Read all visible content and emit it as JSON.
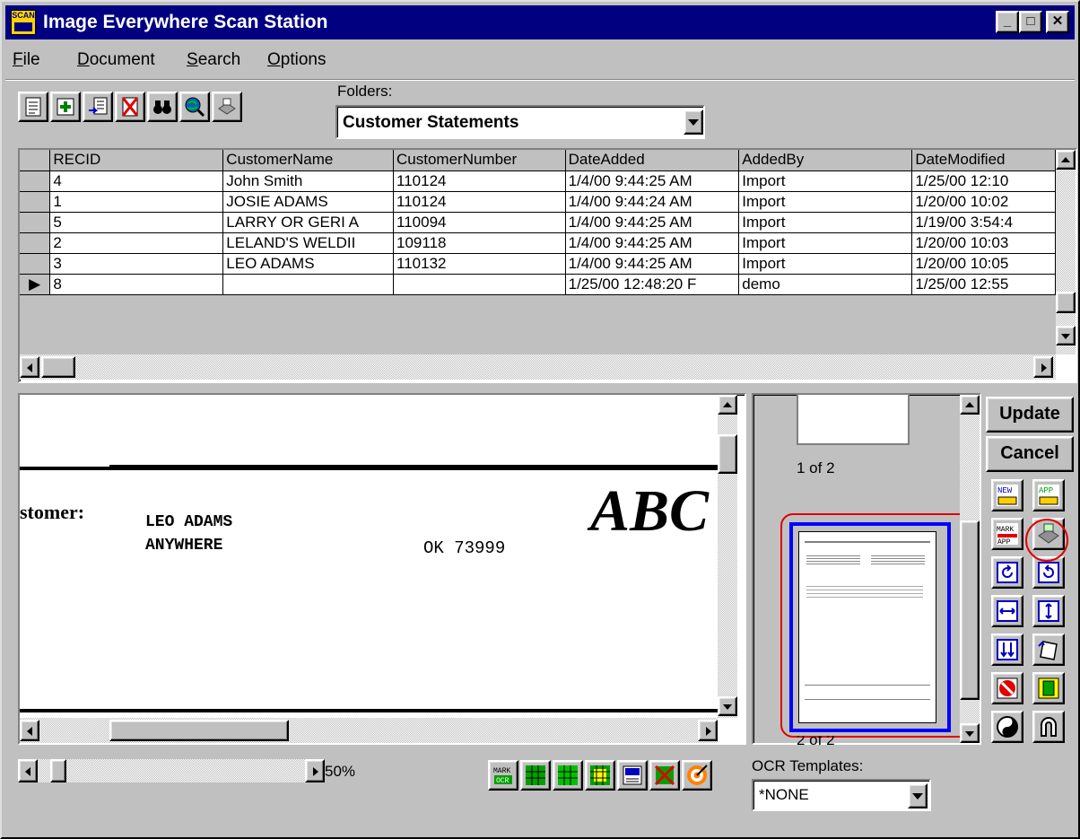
{
  "window": {
    "title": "Image Everywhere Scan Station",
    "icon_text": "SCAN",
    "minimize": "_",
    "maximize": "□",
    "close": "✕"
  },
  "menu": [
    {
      "label": "File",
      "key": "F",
      "rest": "ile"
    },
    {
      "label": "Document",
      "key": "D",
      "rest": "ocument"
    },
    {
      "label": "Search",
      "key": "S",
      "rest": "earch"
    },
    {
      "label": "Options",
      "key": "O",
      "rest": "ptions"
    }
  ],
  "toolbar": {
    "icons": [
      "new-document-icon",
      "add-icon",
      "scan-icon",
      "delete-icon",
      "find-binoculars-icon",
      "web-search-icon",
      "print-icon"
    ],
    "folders_label": "Folders:",
    "folder_value": "Customer Statements"
  },
  "grid": {
    "columns": [
      "RECID",
      "CustomerName",
      "CustomerNumber",
      "DateAdded",
      "AddedBy",
      "DateModified"
    ],
    "rows": [
      {
        "indicator": "",
        "cells": [
          "4",
          "John Smith",
          "110124",
          "1/4/00 9:44:25 AM",
          "Import",
          "1/25/00 12:10"
        ]
      },
      {
        "indicator": "",
        "cells": [
          "1",
          "JOSIE ADAMS",
          "110124",
          "1/4/00 9:44:24 AM",
          "Import",
          "1/20/00 10:02"
        ]
      },
      {
        "indicator": "",
        "cells": [
          "5",
          "LARRY OR GERI A",
          "110094",
          "1/4/00 9:44:25 AM",
          "Import",
          "1/19/00 3:54:4"
        ]
      },
      {
        "indicator": "",
        "cells": [
          "2",
          "LELAND'S WELDII",
          "109118",
          "1/4/00 9:44:25 AM",
          "Import",
          "1/20/00 10:03"
        ]
      },
      {
        "indicator": "",
        "cells": [
          "3",
          "LEO ADAMS",
          "110132",
          "1/4/00 9:44:25 AM",
          "Import",
          "1/20/00 10:05"
        ]
      },
      {
        "indicator": "▶",
        "cells": [
          "8",
          "",
          "",
          "1/25/00 12:48:20 F",
          "demo",
          "1/25/00 12:55"
        ]
      }
    ]
  },
  "document": {
    "customer_label": "stomer:",
    "name": "LEO ADAMS",
    "city": "ANYWHERE",
    "state_zip": "OK 73999",
    "logo_text": "ABC"
  },
  "thumbnails": {
    "page_label": "1 of 2",
    "next_label": "2 of 2"
  },
  "side": {
    "update": "Update",
    "cancel": "Cancel",
    "icons": [
      {
        "name": "new-page-icon",
        "text": "NEW"
      },
      {
        "name": "append-page-icon",
        "text": "APP"
      },
      {
        "name": "mark-append-icon",
        "text": "MARK"
      },
      {
        "name": "scanner-icon",
        "text": ""
      },
      {
        "name": "rotate-left-icon",
        "text": ""
      },
      {
        "name": "rotate-right-icon",
        "text": ""
      },
      {
        "name": "fit-width-icon",
        "text": ""
      },
      {
        "name": "fit-height-icon",
        "text": ""
      },
      {
        "name": "page-down-icon",
        "text": ""
      },
      {
        "name": "flip-page-icon",
        "text": ""
      },
      {
        "name": "despeckle-icon",
        "text": ""
      },
      {
        "name": "crop-icon",
        "text": ""
      },
      {
        "name": "contrast-icon",
        "text": ""
      },
      {
        "name": "magnet-icon",
        "text": ""
      }
    ]
  },
  "bottom": {
    "zoom": "50%",
    "zoom_level": 0.05,
    "ocr_label": "OCR Templates:",
    "ocr_value": "*NONE",
    "icons": [
      "mark-ocr-icon",
      "zone-ocr-icon",
      "full-ocr-icon",
      "grid-icon",
      "ocr-save-icon",
      "clear-ocr-icon",
      "target-icon"
    ]
  },
  "colors": {
    "title_bar": "#000080",
    "highlight_circle": "#e00000",
    "thumb_border": "#0000ff"
  }
}
